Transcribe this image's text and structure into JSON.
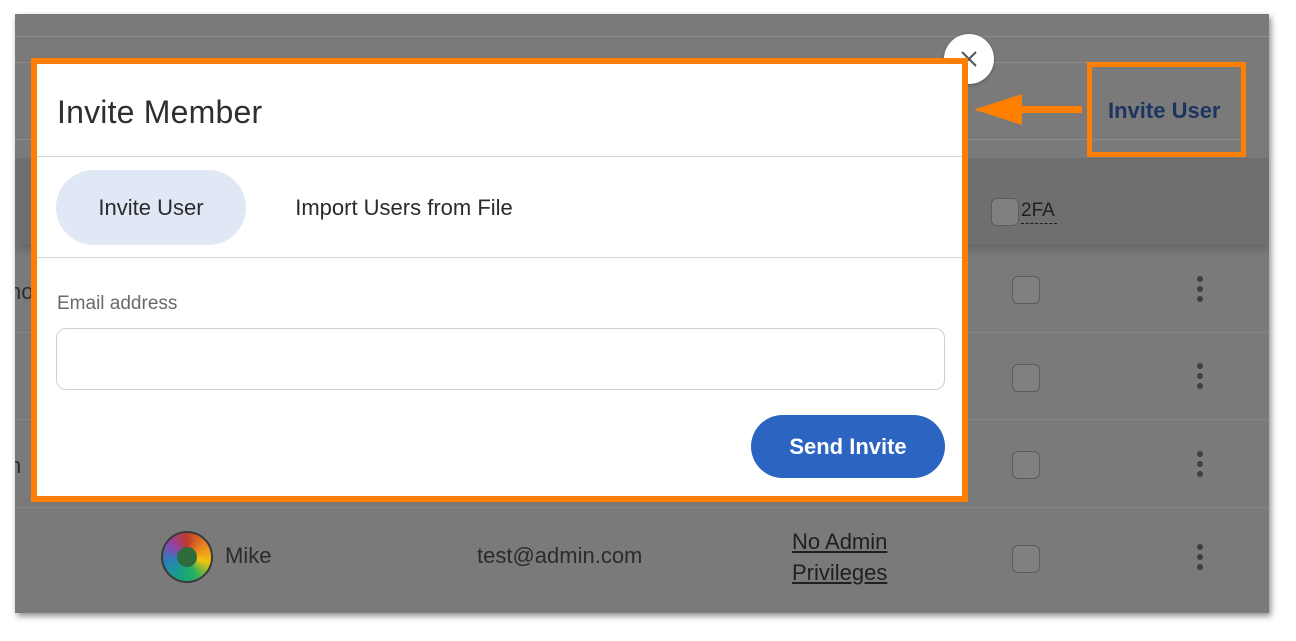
{
  "background": {
    "header_2fa": "2FA",
    "invite_user_link": "Invite User",
    "partial_text_row1": "no",
    "partial_text_row3": "n",
    "member_row": {
      "name": "Mike",
      "email": "test@admin.com",
      "privileges_line1": "No Admin",
      "privileges_line2": "Privileges"
    }
  },
  "modal": {
    "title": "Invite Member",
    "tabs": [
      {
        "label": "Invite User",
        "active": true
      },
      {
        "label": "Import Users from File",
        "active": false
      }
    ],
    "email_label": "Email address",
    "email_value": "",
    "send_button": "Send Invite",
    "close_icon": "close-icon"
  },
  "annotation": {
    "highlight_color": "#ff7f00",
    "arrow_icon": "arrow-left-icon"
  },
  "colors": {
    "primary": "#2b64c1",
    "active_tab": "#dfe8f4",
    "overlay": "#7a7a7a"
  }
}
